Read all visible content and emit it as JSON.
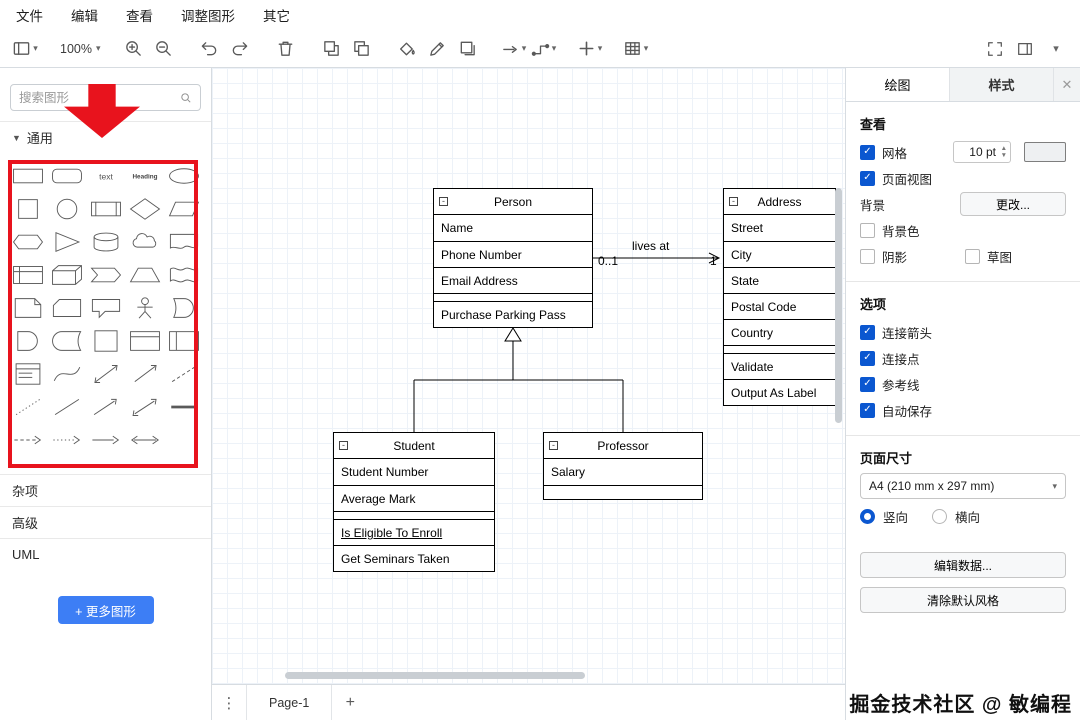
{
  "menu": {
    "items": [
      "文件",
      "编辑",
      "查看",
      "调整图形",
      "其它"
    ]
  },
  "toolbar": {
    "zoom": "100%"
  },
  "sidebar": {
    "search_placeholder": "搜索图形",
    "sections": {
      "general": "通用",
      "misc": "杂项",
      "advanced": "高级",
      "uml": "UML"
    },
    "more_shapes": "+ 更多图形",
    "shapes": [
      "rectangle",
      "rounded-rectangle",
      "text",
      "heading",
      "ellipse",
      "square",
      "circle",
      "process",
      "diamond",
      "parallelogram",
      "hexagon",
      "triangle",
      "cylinder",
      "cloud",
      "document",
      "internal-storage",
      "cube",
      "step",
      "trapezoid",
      "tape",
      "note",
      "card",
      "callout",
      "actor",
      "or",
      "and",
      "data-storage",
      "container",
      "horizontal-container",
      "vertical-container",
      "list",
      "curve",
      "bidirectional-arrow",
      "arrow",
      "dashed-line",
      "dotted-line",
      "line",
      "directional-connector",
      "bidirectional-connector",
      "link",
      "dashed-edge",
      "dotted-edge",
      "edge",
      "bidirectional-edge"
    ]
  },
  "canvas": {
    "classes": {
      "person": {
        "title": "Person",
        "attributes": [
          "Name",
          "Phone Number",
          "Email Address"
        ],
        "methods": [
          {
            "label": "Purchase Parking Pass"
          }
        ]
      },
      "address": {
        "title": "Address",
        "attributes": [
          "Street",
          "City",
          "State",
          "Postal Code",
          "Country"
        ],
        "methods": [
          {
            "label": "Validate"
          },
          {
            "label": "Output As Label"
          }
        ]
      },
      "student": {
        "title": "Student",
        "attributes": [
          "Student Number",
          "Average Mark"
        ],
        "methods": [
          {
            "label": "Is Eligible To Enroll",
            "underline": true
          },
          {
            "label": "Get Seminars Taken"
          }
        ]
      },
      "professor": {
        "title": "Professor",
        "attributes": [
          "Salary"
        ],
        "methods": []
      }
    },
    "edge": {
      "label": "lives at",
      "source_multiplicity": "0..1",
      "target_multiplicity": "1"
    }
  },
  "format_panel": {
    "tabs": {
      "diagram": "绘图",
      "style": "样式"
    },
    "view": {
      "heading": "查看",
      "grid": "网格",
      "grid_size": "10 pt",
      "page_view": "页面视图",
      "background": "背景",
      "change_button": "更改...",
      "background_color": "背景色",
      "shadow": "阴影",
      "sketch": "草图"
    },
    "options": {
      "heading": "选项",
      "items": [
        {
          "label": "连接箭头",
          "checked": true
        },
        {
          "label": "连接点",
          "checked": true
        },
        {
          "label": "参考线",
          "checked": true
        },
        {
          "label": "自动保存",
          "checked": true
        }
      ]
    },
    "paper": {
      "heading": "页面尺寸",
      "size": "A4 (210 mm x 297 mm)",
      "portrait": "竖向",
      "landscape": "横向"
    },
    "edit_data": "编辑数据...",
    "clear_default_style": "清除默认风格"
  },
  "footer": {
    "page": "Page-1"
  },
  "watermark": "掘金技术社区 @ 敏编程"
}
